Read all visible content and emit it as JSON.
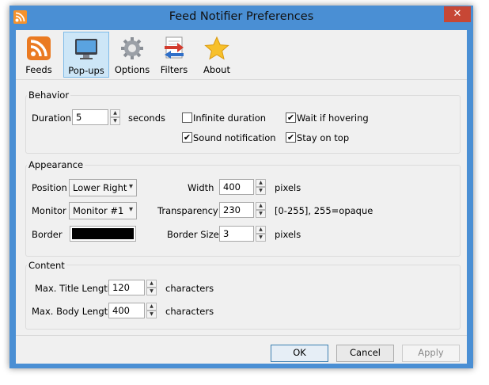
{
  "window": {
    "title": "Feed Notifier Preferences",
    "close_glyph": "✕"
  },
  "toolbar": {
    "tabs": [
      {
        "label": "Feeds",
        "icon": "rss-icon"
      },
      {
        "label": "Pop-ups",
        "icon": "monitor-icon",
        "selected": true
      },
      {
        "label": "Options",
        "icon": "gear-icon"
      },
      {
        "label": "Filters",
        "icon": "filter-arrows-icon"
      },
      {
        "label": "About",
        "icon": "star-icon"
      }
    ]
  },
  "behavior": {
    "title": "Behavior",
    "duration_label": "Duration",
    "duration_value": "5",
    "seconds_label": "seconds",
    "infinite_duration": {
      "label": "Infinite duration",
      "checked": false
    },
    "wait_if_hovering": {
      "label": "Wait if hovering",
      "checked": true
    },
    "sound_notification": {
      "label": "Sound notification",
      "checked": true
    },
    "stay_on_top": {
      "label": "Stay on top",
      "checked": true
    }
  },
  "appearance": {
    "title": "Appearance",
    "position_label": "Position",
    "position_value": "Lower Right",
    "monitor_label": "Monitor",
    "monitor_value": "Monitor #1",
    "border_label": "Border",
    "border_color": "#000000",
    "width_label": "Width",
    "width_value": "400",
    "width_unit": "pixels",
    "transparency_label": "Transparency",
    "transparency_value": "230",
    "transparency_hint": "[0-255], 255=opaque",
    "border_size_label": "Border Size",
    "border_size_value": "3",
    "border_size_unit": "pixels"
  },
  "content": {
    "title": "Content",
    "max_title_label": "Max. Title Length",
    "max_title_value": "120",
    "max_title_unit": "characters",
    "max_body_label": "Max. Body Length",
    "max_body_value": "400",
    "max_body_unit": "characters"
  },
  "buttons": {
    "ok": "OK",
    "cancel": "Cancel",
    "apply": "Apply"
  },
  "colors": {
    "titlebar": "#4a8fd4",
    "close": "#c74735",
    "selected_tab": "#cde6f7"
  }
}
